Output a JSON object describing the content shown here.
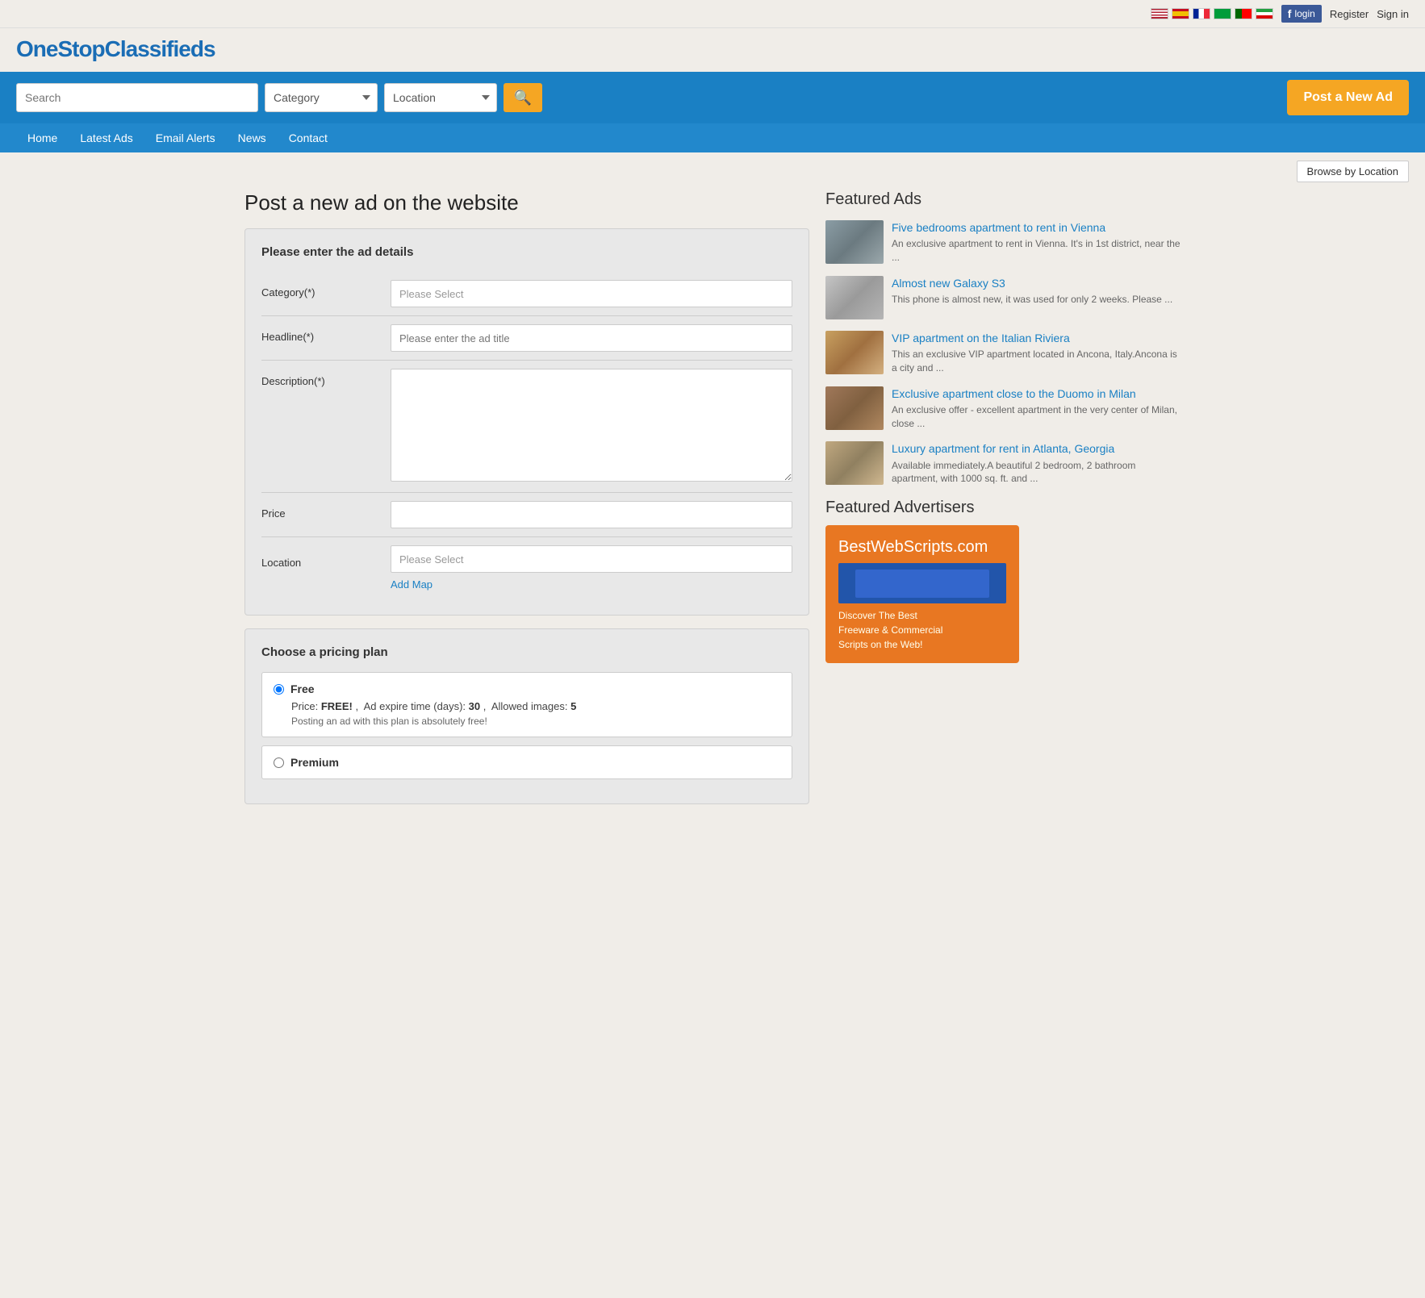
{
  "topbar": {
    "register": "Register",
    "signin": "Sign in",
    "fb_login": "login"
  },
  "header": {
    "logo": "OneStopClassifieds"
  },
  "search": {
    "placeholder": "Search",
    "category_label": "Category",
    "location_label": "Location",
    "search_icon": "🔍"
  },
  "post_ad_button": "Post a New Ad",
  "nav": {
    "items": [
      {
        "label": "Home",
        "href": "#"
      },
      {
        "label": "Latest Ads",
        "href": "#"
      },
      {
        "label": "Email Alerts",
        "href": "#"
      },
      {
        "label": "News",
        "href": "#"
      },
      {
        "label": "Contact",
        "href": "#"
      }
    ]
  },
  "browse_button": "Browse by Location",
  "page_title": "Post a new ad on the website",
  "form": {
    "card_title": "Please enter the ad details",
    "category_label": "Category(*)",
    "category_placeholder": "Please Select",
    "headline_label": "Headline(*)",
    "headline_placeholder": "Please enter the ad title",
    "description_label": "Description(*)",
    "price_label": "Price",
    "location_label": "Location",
    "location_placeholder": "Please Select",
    "add_map": "Add Map"
  },
  "pricing": {
    "title": "Choose a pricing plan",
    "plans": [
      {
        "name": "Free",
        "detail": "Price: FREE! ,  Ad expire time (days): 30 ,  Allowed images: 5",
        "note": "Posting an ad with this plan is absolutely free!",
        "selected": true
      },
      {
        "name": "Premium",
        "detail": "",
        "note": "",
        "selected": false
      }
    ]
  },
  "sidebar": {
    "featured_title": "Featured Ads",
    "items": [
      {
        "title": "Five bedrooms apartment to rent in Vienna",
        "desc": "An exclusive apartment to rent in Vienna. It's in 1st district, near the ...",
        "thumb_class": "thumb-apt1"
      },
      {
        "title": "Almost new Galaxy S3",
        "desc": "This phone is almost new, it was used for only 2 weeks. Please ...",
        "thumb_class": "thumb-phone"
      },
      {
        "title": "VIP apartment on the Italian Riviera",
        "desc": "This an exclusive VIP apartment located in Ancona, Italy.Ancona is a city and ...",
        "thumb_class": "thumb-riviera"
      },
      {
        "title": "Exclusive apartment close to the Duomo in Milan",
        "desc": "An exclusive offer - excellent apartment in the very center of Milan, close ...",
        "thumb_class": "thumb-milan"
      },
      {
        "title": "Luxury apartment for rent in Atlanta, Georgia",
        "desc": "Available immediately.A beautiful 2 bedroom, 2 bathroom apartment, with 1000 sq. ft. and ...",
        "thumb_class": "thumb-atlanta"
      }
    ],
    "advertisers_title": "Featured Advertisers",
    "banner": {
      "title": "BestWebScripts",
      "title_suffix": ".com",
      "line1": "Discover The Best",
      "line2": "Freeware & Commercial",
      "line3": "Scripts on the Web!"
    }
  }
}
